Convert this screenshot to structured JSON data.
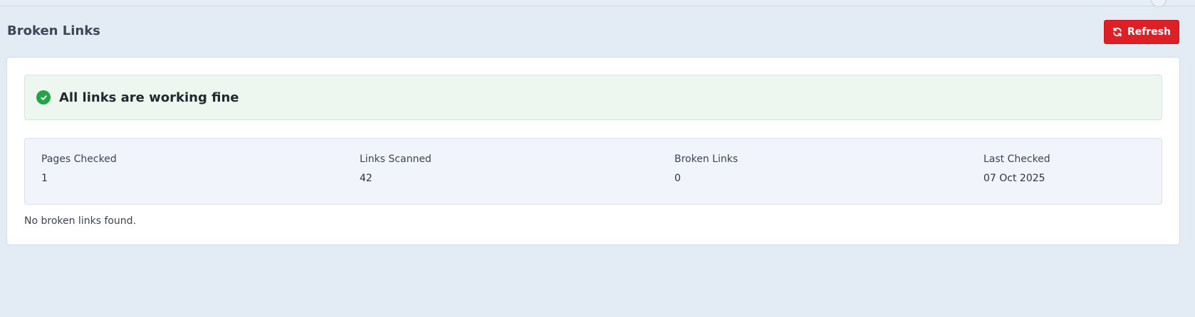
{
  "page": {
    "title": "Broken Links",
    "refresh_label": "Refresh"
  },
  "status": {
    "message": "All links are working fine",
    "color": "#22a447"
  },
  "stats": [
    {
      "label": "Pages Checked",
      "value": "1"
    },
    {
      "label": "Links Scanned",
      "value": "42"
    },
    {
      "label": "Broken Links",
      "value": "0"
    },
    {
      "label": "Last Checked",
      "value": "07 Oct 2025"
    }
  ],
  "results": {
    "empty_message": "No broken links found."
  },
  "colors": {
    "accent_button": "#dc2026",
    "page_background": "#e3ebf5",
    "success_background": "#edf7ef"
  },
  "icons": {
    "refresh": "refresh-icon",
    "status": "check-circle-icon"
  }
}
